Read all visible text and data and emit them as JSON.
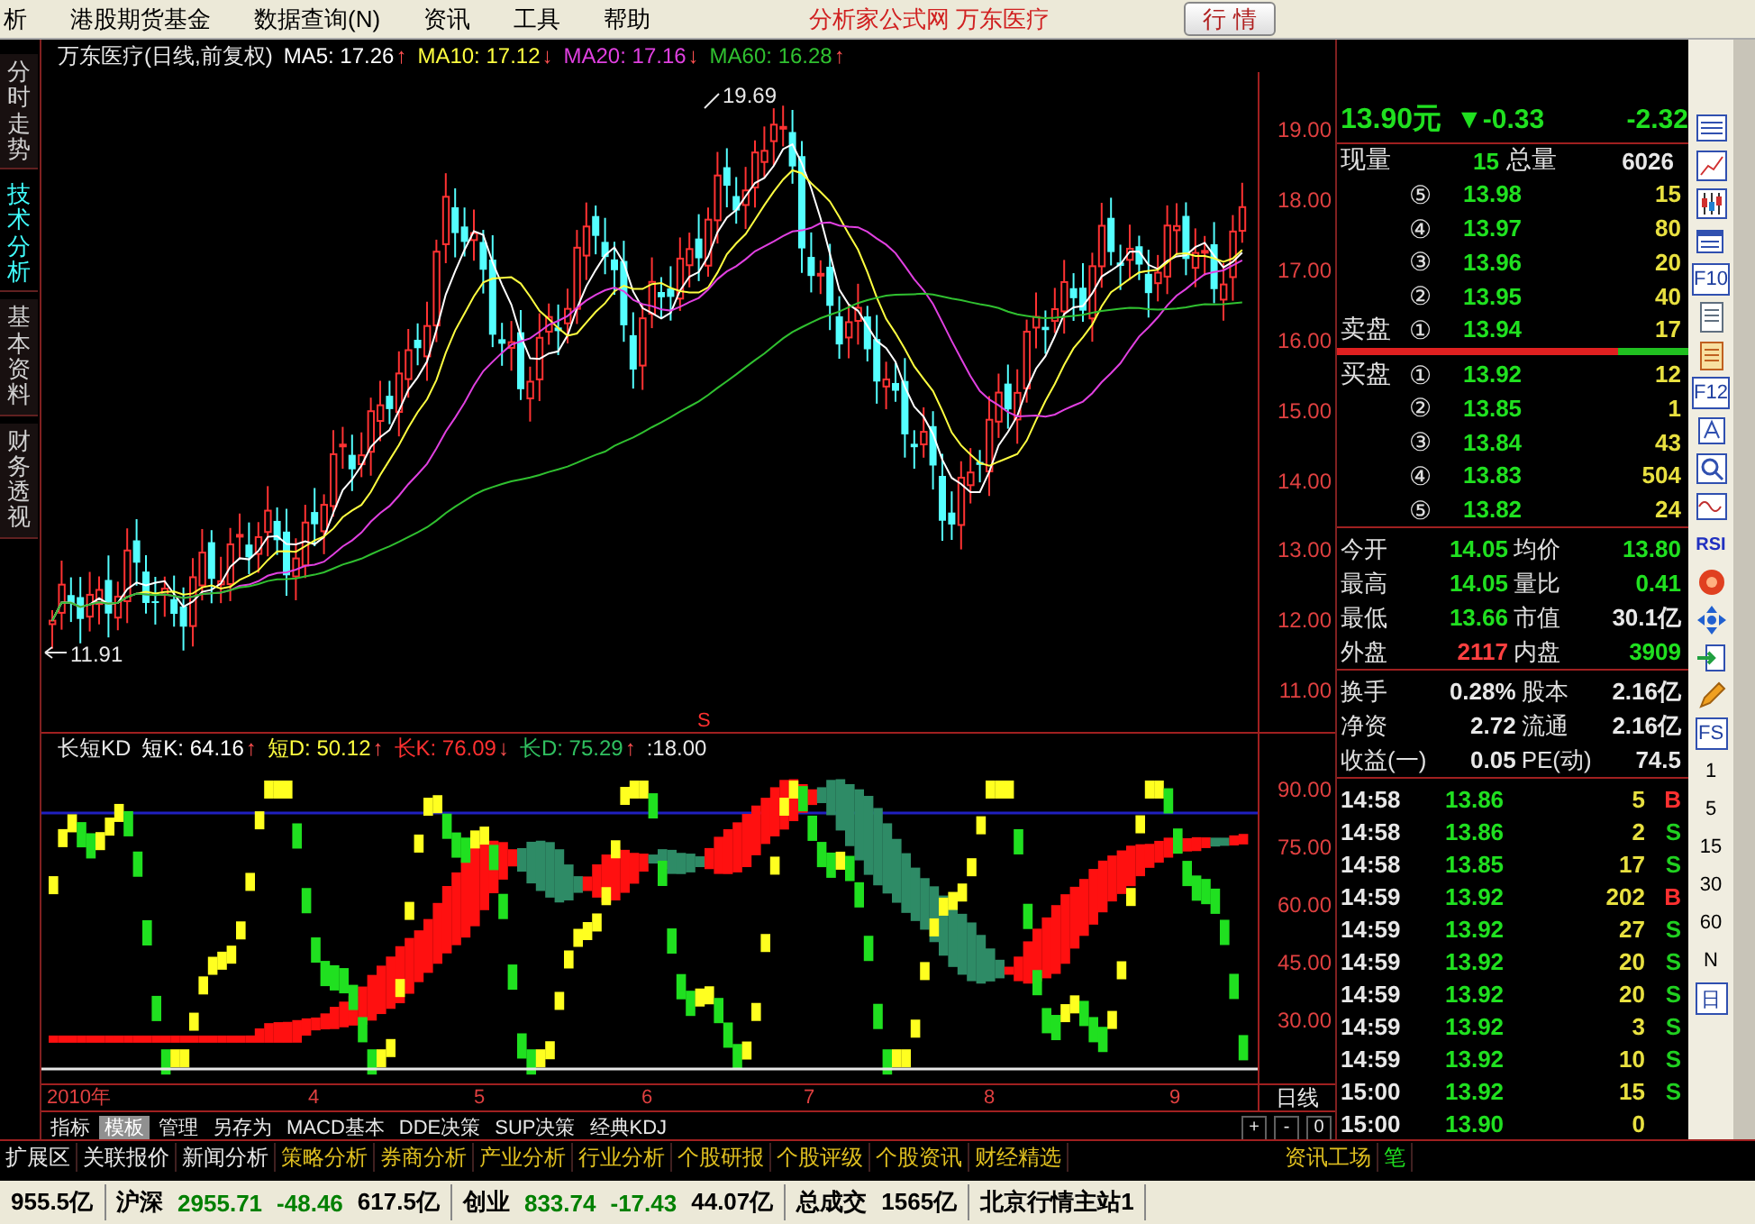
{
  "menu": {
    "items": [
      "析",
      "港股期货基金",
      "数据查询(N)",
      "资讯",
      "工具",
      "帮助"
    ],
    "title": "分析家公式网 万东医疗",
    "button": "行 情"
  },
  "side_tabs": [
    {
      "label": "分时走势",
      "selected": false
    },
    {
      "label": "技术分析",
      "selected": true
    },
    {
      "label": "基本资料",
      "selected": false
    },
    {
      "label": "财务透视",
      "selected": false
    }
  ],
  "price_chart": {
    "title": "万东医疗(日线,前复权)",
    "indicators": [
      {
        "label": "MA5: 17.26",
        "arrow": "↑",
        "color": "#ffffff"
      },
      {
        "label": "MA10: 17.12",
        "arrow": "↓",
        "color": "#ffff40"
      },
      {
        "label": "MA20: 17.16",
        "arrow": "↓",
        "color": "#e040e0"
      },
      {
        "label": "MA60: 16.28",
        "arrow": "↑",
        "color": "#30c030"
      }
    ],
    "axis_labels": [
      "19.00",
      "18.00",
      "17.00",
      "16.00",
      "15.00",
      "14.00",
      "13.00",
      "12.00",
      "11.00"
    ],
    "high_label": "19.69",
    "low_label": "11.91",
    "signal": "S"
  },
  "kd_chart": {
    "title": "长短KD",
    "indicators": [
      {
        "label": "短K: 64.16",
        "arrow": "↑",
        "color": "#ffffff"
      },
      {
        "label": "短D: 50.12",
        "arrow": "↑",
        "color": "#ffff40"
      },
      {
        "label": "长K: 76.09",
        "arrow": "↓",
        "color": "#ff3030"
      },
      {
        "label": "长D: 75.29",
        "arrow": "↑",
        "color": "#30c060"
      }
    ],
    "threshold": ":18.00",
    "axis_labels": [
      "90.00",
      "75.00",
      "60.00",
      "45.00",
      "30.00"
    ]
  },
  "time_axis": {
    "labels": [
      "2010年",
      "4",
      "5",
      "6",
      "7",
      "8",
      "9"
    ],
    "period": "日线"
  },
  "bottom_tabs": [
    {
      "label": "指标",
      "selected": false
    },
    {
      "label": "模板",
      "selected": true
    },
    {
      "label": "管理",
      "selected": false
    },
    {
      "label": "另存为",
      "selected": false
    },
    {
      "label": "MACD基本",
      "selected": false
    },
    {
      "label": "DDE决策",
      "selected": false
    },
    {
      "label": "SUP决策",
      "selected": false
    },
    {
      "label": "经典KDJ",
      "selected": false
    }
  ],
  "zoom_buttons": [
    "+",
    "-",
    "0"
  ],
  "info_tabs": [
    {
      "label": "扩展区",
      "color": "#e8e8e8"
    },
    {
      "label": "关联报价",
      "color": "#e8e8e8"
    },
    {
      "label": "新闻分析",
      "color": "#e8e8e8"
    },
    {
      "label": "策略分析",
      "color": "#e0c020"
    },
    {
      "label": "券商分析",
      "color": "#e0c020"
    },
    {
      "label": "产业分析",
      "color": "#e0c020"
    },
    {
      "label": "行业分析",
      "color": "#e0c020"
    },
    {
      "label": "个股研报",
      "color": "#e0c020"
    },
    {
      "label": "个股评级",
      "color": "#e0c020"
    },
    {
      "label": "个股资讯",
      "color": "#e0c020"
    },
    {
      "label": "财经精选",
      "color": "#e0c020"
    }
  ],
  "info_right": [
    "资讯工场",
    "笔"
  ],
  "quote": {
    "price": "13.90元",
    "change": "▼-0.33",
    "percent": "-2.32"
  },
  "volume_row": {
    "label": "现量",
    "value": "15",
    "total_label": "总量",
    "total": "6026"
  },
  "asks": [
    {
      "level": "⑤",
      "price": "13.98",
      "volume": "15"
    },
    {
      "level": "④",
      "price": "13.97",
      "volume": "80"
    },
    {
      "level": "③",
      "price": "13.96",
      "volume": "20"
    },
    {
      "level": "②",
      "price": "13.95",
      "volume": "40"
    },
    {
      "label": "卖盘",
      "level": "①",
      "price": "13.94",
      "volume": "17"
    }
  ],
  "bid_ask_bar": {
    "level": 0.8
  },
  "bids": [
    {
      "label": "买盘",
      "level": "①",
      "price": "13.92",
      "volume": "12"
    },
    {
      "level": "②",
      "price": "13.85",
      "volume": "1"
    },
    {
      "level": "③",
      "price": "13.84",
      "volume": "43"
    },
    {
      "level": "④",
      "price": "13.83",
      "volume": "504"
    },
    {
      "level": "⑤",
      "price": "13.82",
      "volume": "24"
    }
  ],
  "stats": [
    {
      "label": "今开",
      "value": "14.05",
      "color": "#20e020"
    },
    {
      "label": "均价",
      "value": "13.80",
      "color": "#20e020"
    },
    {
      "label": "最高",
      "value": "14.05",
      "color": "#20e020"
    },
    {
      "label": "量比",
      "value": "0.41",
      "color": "#20e020"
    },
    {
      "label": "最低",
      "value": "13.66",
      "color": "#20e020"
    },
    {
      "label": "市值",
      "value": "30.1亿",
      "color": "#e8e8e8"
    },
    {
      "label": "外盘",
      "value": "2117",
      "color": "#ff4040"
    },
    {
      "label": "内盘",
      "value": "3909",
      "color": "#20e020"
    }
  ],
  "stats2": [
    {
      "label": "换手",
      "value": "0.28%"
    },
    {
      "label": "股本",
      "value": "2.16亿"
    },
    {
      "label": "净资",
      "value": "2.72"
    },
    {
      "label": "流通",
      "value": "2.16亿"
    },
    {
      "label": "收益(一)",
      "value": "0.05"
    },
    {
      "label": "PE(动)",
      "value": "74.5"
    }
  ],
  "ticks": [
    {
      "time": "14:58",
      "price": "13.86",
      "volume": "5",
      "side": "B",
      "color": "#ff3030"
    },
    {
      "time": "14:58",
      "price": "13.86",
      "volume": "2",
      "side": "S",
      "color": "#20d020"
    },
    {
      "time": "14:58",
      "price": "13.85",
      "volume": "17",
      "side": "S",
      "color": "#20d020"
    },
    {
      "time": "14:59",
      "price": "13.92",
      "volume": "202",
      "side": "B",
      "color": "#ff3030"
    },
    {
      "time": "14:59",
      "price": "13.92",
      "volume": "27",
      "side": "S",
      "color": "#20d020"
    },
    {
      "time": "14:59",
      "price": "13.92",
      "volume": "20",
      "side": "S",
      "color": "#20d020"
    },
    {
      "time": "14:59",
      "price": "13.92",
      "volume": "20",
      "side": "S",
      "color": "#20d020"
    },
    {
      "time": "14:59",
      "price": "13.92",
      "volume": "3",
      "side": "S",
      "color": "#20d020"
    },
    {
      "time": "14:59",
      "price": "13.92",
      "volume": "10",
      "side": "S",
      "color": "#20d020"
    },
    {
      "time": "15:00",
      "price": "13.92",
      "volume": "15",
      "side": "S",
      "color": "#20d020"
    },
    {
      "time": "15:00",
      "price": "13.90",
      "volume": "0"
    }
  ],
  "toolbar": [
    {
      "label": "F10",
      "kind": "boxed"
    },
    {
      "label": "F12",
      "kind": "boxed"
    },
    {
      "label": "RSI",
      "kind": "bold"
    },
    {
      "label": "FS",
      "kind": "boxed"
    },
    {
      "label": "1",
      "kind": "plain"
    },
    {
      "label": "5",
      "kind": "plain"
    },
    {
      "label": "15",
      "kind": "plain"
    },
    {
      "label": "30",
      "kind": "plain"
    },
    {
      "label": "60",
      "kind": "plain"
    },
    {
      "label": "N",
      "kind": "plain"
    },
    {
      "label": "日",
      "kind": "boxed"
    }
  ],
  "status_bar": [
    [
      {
        "text": "955.5亿",
        "color": "#000000"
      }
    ],
    [
      {
        "text": "沪深",
        "color": "#000000"
      },
      {
        "text": "2955.71",
        "color": "#008000"
      },
      {
        "text": "-48.46",
        "color": "#008000"
      },
      {
        "text": "617.5亿",
        "color": "#000000"
      }
    ],
    [
      {
        "text": "创业",
        "color": "#000000"
      },
      {
        "text": "833.74",
        "color": "#008000"
      },
      {
        "text": "-17.43",
        "color": "#008000"
      },
      {
        "text": "44.07亿",
        "color": "#000000"
      }
    ],
    [
      {
        "text": "总成交",
        "color": "#000000"
      },
      {
        "text": "1565亿",
        "color": "#000000"
      }
    ],
    [
      {
        "text": "北京行情主站1",
        "color": "#000000"
      }
    ]
  ]
}
